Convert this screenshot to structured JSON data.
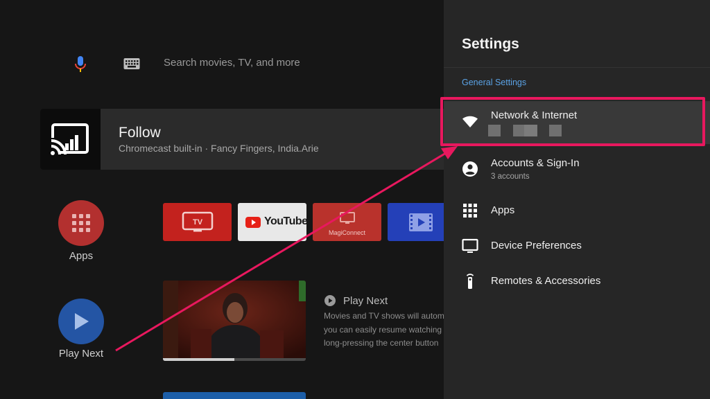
{
  "home": {
    "search": {
      "placeholder": "Search movies, TV, and more"
    },
    "follow_card": {
      "title": "Follow",
      "subtitle": "Chromecast built-in · Fancy Fingers, India.Arie"
    },
    "launchers": {
      "apps_label": "Apps",
      "play_next_label": "Play Next"
    },
    "tiles": {
      "tv_label": "TV",
      "youtube_label": "YouTube",
      "magiconnect_label": "MagiConnect"
    },
    "play_next_card": {
      "title": "Play Next",
      "line1": "Movies and TV shows will autom",
      "line2": "you can easily resume watching",
      "line3": "long-pressing the center button",
      "progress": 0.5
    }
  },
  "settings": {
    "title": "Settings",
    "section_label": "General Settings",
    "items": [
      {
        "label": "Network & Internet",
        "icon": "wifi-icon"
      },
      {
        "label": "Accounts & Sign-In",
        "sub": "3 accounts",
        "icon": "account-icon"
      },
      {
        "label": "Apps",
        "icon": "apps-grid-icon"
      },
      {
        "label": "Device Preferences",
        "icon": "tv-display-icon"
      },
      {
        "label": "Remotes & Accessories",
        "icon": "remote-icon"
      }
    ]
  },
  "colors": {
    "accent_blue": "#5ba3e6",
    "annotation_pink": "#e8185e",
    "apps_red": "#b3302f",
    "play_next_blue": "#2455a4"
  }
}
